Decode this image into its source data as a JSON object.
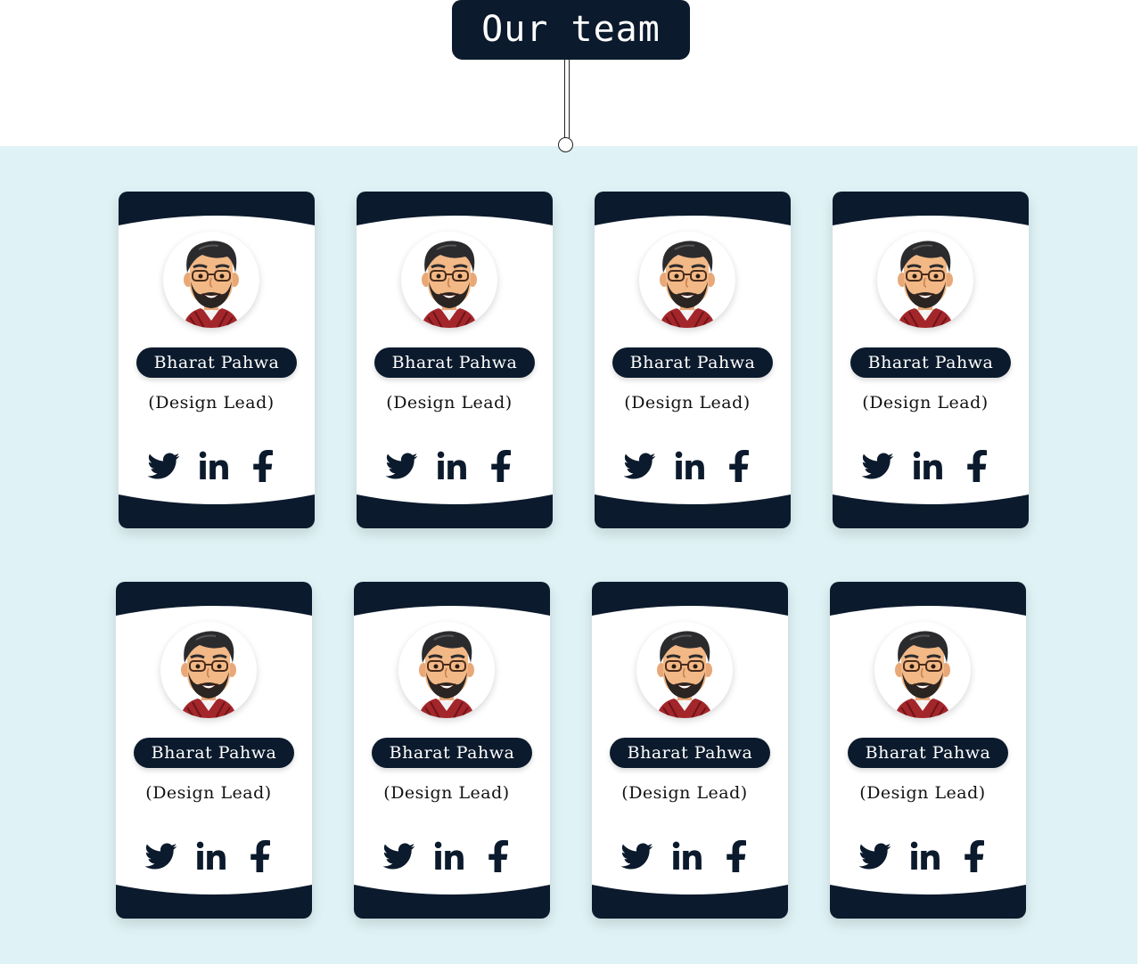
{
  "header": {
    "title": "Our team"
  },
  "colors": {
    "navy": "#0b1a2c",
    "section_background": "#dff2f5",
    "card_background": "#ffffff"
  },
  "team": {
    "members": [
      {
        "name": "Bharat Pahwa",
        "role": "(Design Lead)",
        "avatar_icon": "bitmoji-avatar-icon",
        "social_icons": [
          "twitter-icon",
          "linkedin-icon",
          "facebook-icon"
        ]
      },
      {
        "name": "Bharat Pahwa",
        "role": "(Design Lead)",
        "avatar_icon": "bitmoji-avatar-icon",
        "social_icons": [
          "twitter-icon",
          "linkedin-icon",
          "facebook-icon"
        ]
      },
      {
        "name": "Bharat Pahwa",
        "role": "(Design Lead)",
        "avatar_icon": "bitmoji-avatar-icon",
        "social_icons": [
          "twitter-icon",
          "linkedin-icon",
          "facebook-icon"
        ]
      },
      {
        "name": "Bharat Pahwa",
        "role": "(Design Lead)",
        "avatar_icon": "bitmoji-avatar-icon",
        "social_icons": [
          "twitter-icon",
          "linkedin-icon",
          "facebook-icon"
        ]
      },
      {
        "name": "Bharat Pahwa",
        "role": "(Design Lead)",
        "avatar_icon": "bitmoji-avatar-icon",
        "social_icons": [
          "twitter-icon",
          "linkedin-icon",
          "facebook-icon"
        ]
      },
      {
        "name": "Bharat Pahwa",
        "role": "(Design Lead)",
        "avatar_icon": "bitmoji-avatar-icon",
        "social_icons": [
          "twitter-icon",
          "linkedin-icon",
          "facebook-icon"
        ]
      },
      {
        "name": "Bharat Pahwa",
        "role": "(Design Lead)",
        "avatar_icon": "bitmoji-avatar-icon",
        "social_icons": [
          "twitter-icon",
          "linkedin-icon",
          "facebook-icon"
        ]
      },
      {
        "name": "Bharat Pahwa",
        "role": "(Design Lead)",
        "avatar_icon": "bitmoji-avatar-icon",
        "social_icons": [
          "twitter-icon",
          "linkedin-icon",
          "facebook-icon"
        ]
      }
    ]
  }
}
